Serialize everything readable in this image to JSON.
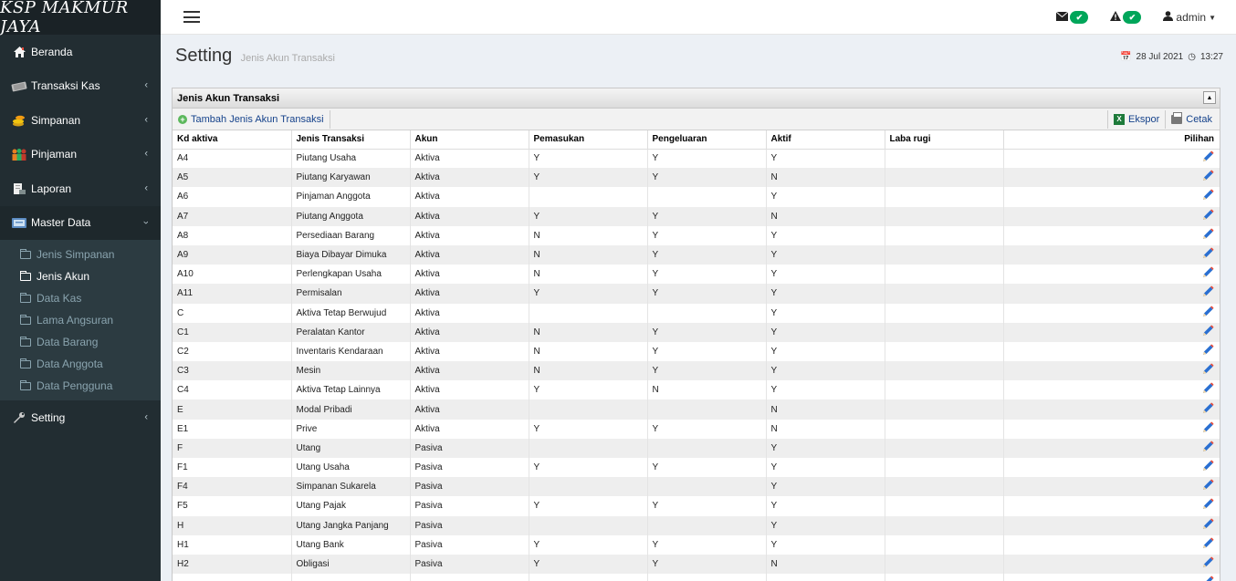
{
  "brand": "KSP MAKMUR JAYA",
  "sidebar": {
    "items": [
      {
        "label": "Beranda",
        "icon": "home-icon",
        "chevron": false
      },
      {
        "label": "Transaksi Kas",
        "icon": "cash-icon",
        "chevron": true
      },
      {
        "label": "Simpanan",
        "icon": "coins-icon",
        "chevron": true
      },
      {
        "label": "Pinjaman",
        "icon": "people-icon",
        "chevron": true
      },
      {
        "label": "Laporan",
        "icon": "report-icon",
        "chevron": true
      },
      {
        "label": "Master Data",
        "icon": "database-icon",
        "chevron": true
      },
      {
        "label": "Setting",
        "icon": "wrench-icon",
        "chevron": true
      }
    ],
    "submenu": [
      "Jenis Simpanan",
      "Jenis Akun",
      "Data Kas",
      "Lama Angsuran",
      "Data Barang",
      "Data Anggota",
      "Data Pengguna"
    ],
    "active_sub": "Jenis Akun"
  },
  "topbar": {
    "user": "admin"
  },
  "header": {
    "title": "Setting",
    "subtitle": "Jenis Akun Transaksi",
    "date": "28 Jul 2021",
    "time": "13:27"
  },
  "grid": {
    "title": "Jenis Akun Transaksi",
    "add_label": "Tambah Jenis Akun Transaksi",
    "export_label": "Ekspor",
    "print_label": "Cetak",
    "columns": [
      "Kd aktiva",
      "Jenis Transaksi",
      "Akun",
      "Pemasukan",
      "Pengeluaran",
      "Aktif",
      "Laba rugi",
      "Pilihan"
    ],
    "rows": [
      [
        "A4",
        "Piutang Usaha",
        "Aktiva",
        "Y",
        "Y",
        "Y",
        ""
      ],
      [
        "A5",
        "Piutang Karyawan",
        "Aktiva",
        "Y",
        "Y",
        "N",
        ""
      ],
      [
        "A6",
        "Pinjaman Anggota",
        "Aktiva",
        "",
        "",
        "Y",
        ""
      ],
      [
        "A7",
        "Piutang Anggota",
        "Aktiva",
        "Y",
        "Y",
        "N",
        ""
      ],
      [
        "A8",
        "Persediaan Barang",
        "Aktiva",
        "N",
        "Y",
        "Y",
        ""
      ],
      [
        "A9",
        "Biaya Dibayar Dimuka",
        "Aktiva",
        "N",
        "Y",
        "Y",
        ""
      ],
      [
        "A10",
        "Perlengkapan Usaha",
        "Aktiva",
        "N",
        "Y",
        "Y",
        ""
      ],
      [
        "A11",
        "Permisalan",
        "Aktiva",
        "Y",
        "Y",
        "Y",
        ""
      ],
      [
        "C",
        "Aktiva Tetap Berwujud",
        "Aktiva",
        "",
        "",
        "Y",
        ""
      ],
      [
        "C1",
        "Peralatan Kantor",
        "Aktiva",
        "N",
        "Y",
        "Y",
        ""
      ],
      [
        "C2",
        "Inventaris Kendaraan",
        "Aktiva",
        "N",
        "Y",
        "Y",
        ""
      ],
      [
        "C3",
        "Mesin",
        "Aktiva",
        "N",
        "Y",
        "Y",
        ""
      ],
      [
        "C4",
        "Aktiva Tetap Lainnya",
        "Aktiva",
        "Y",
        "N",
        "Y",
        ""
      ],
      [
        "E",
        "Modal Pribadi",
        "Aktiva",
        "",
        "",
        "N",
        ""
      ],
      [
        "E1",
        "Prive",
        "Aktiva",
        "Y",
        "Y",
        "N",
        ""
      ],
      [
        "F",
        "Utang",
        "Pasiva",
        "",
        "",
        "Y",
        ""
      ],
      [
        "F1",
        "Utang Usaha",
        "Pasiva",
        "Y",
        "Y",
        "Y",
        ""
      ],
      [
        "F4",
        "Simpanan Sukarela",
        "Pasiva",
        "",
        "",
        "Y",
        ""
      ],
      [
        "F5",
        "Utang Pajak",
        "Pasiva",
        "Y",
        "Y",
        "Y",
        ""
      ],
      [
        "H",
        "Utang Jangka Panjang",
        "Pasiva",
        "",
        "",
        "Y",
        ""
      ],
      [
        "H1",
        "Utang Bank",
        "Pasiva",
        "Y",
        "Y",
        "Y",
        ""
      ],
      [
        "H2",
        "Obligasi",
        "Pasiva",
        "Y",
        "Y",
        "N",
        ""
      ],
      [
        "",
        "",
        "",
        "",
        "",
        "",
        ""
      ]
    ]
  }
}
